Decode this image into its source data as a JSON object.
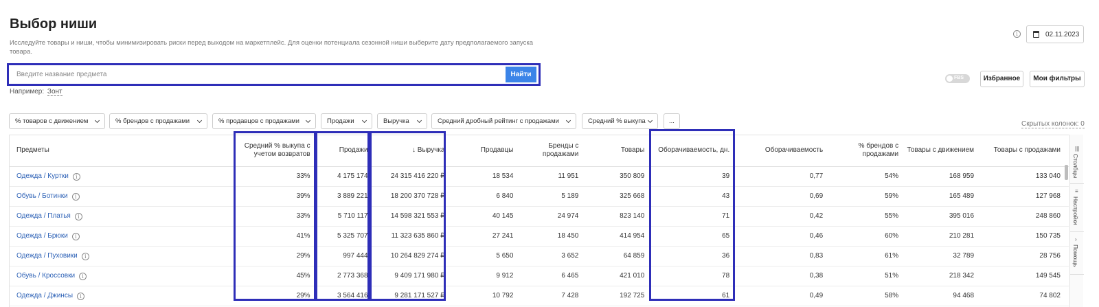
{
  "page": {
    "title": "Выбор ниши",
    "subtitle": "Исследуйте товары и ниши, чтобы минимизировать риски перед выходом на маркетплейс. Для оценки потенциала сезонной ниши выберите дату предполагаемого запуска товара."
  },
  "search": {
    "placeholder": "Введите название предмета",
    "button_label": "Найти",
    "example_label": "Например:",
    "example_value": "Зонт"
  },
  "header": {
    "info_icon": "info-icon",
    "date": "02.11.2023",
    "fbs_label": "FBS",
    "favorites_label": "Избранное",
    "my_filters_label": "Мои фильтры"
  },
  "filters": {
    "chips": [
      "% товаров с движением",
      "% брендов с продажами",
      "% продавцов с продажами",
      "Продажи",
      "Выручка",
      "Средний дробный рейтинг с продажами",
      "Средний % выкупа"
    ],
    "more_label": "...",
    "hidden_columns": "Скрытых колонок: 0"
  },
  "table": {
    "columns": [
      "Предметы",
      "Средний % выкупа с учетом возвратов",
      "Продажи",
      "↓ Выручка",
      "Продавцы",
      "Бренды с продажами",
      "Товары",
      "Оборачиваемость, дн.",
      "Оборачиваемость",
      "% брендов с продажами",
      "Товары с движением",
      "Товары с продажами"
    ],
    "rows": [
      [
        "Одежда / Куртки",
        "33%",
        "4 175 174",
        "24 315 416 220 ₽",
        "18 534",
        "11 951",
        "350 809",
        "39",
        "0,77",
        "54%",
        "168 959",
        "133 040"
      ],
      [
        "Обувь / Ботинки",
        "39%",
        "3 889 221",
        "18 200 370 728 ₽",
        "6 840",
        "5 189",
        "325 668",
        "43",
        "0,69",
        "59%",
        "165 489",
        "127 968"
      ],
      [
        "Одежда / Платья",
        "33%",
        "5 710 117",
        "14 598 321 553 ₽",
        "40 145",
        "24 974",
        "823 140",
        "71",
        "0,42",
        "55%",
        "395 016",
        "248 860"
      ],
      [
        "Одежда / Брюки",
        "41%",
        "5 325 707",
        "11 323 635 860 ₽",
        "27 241",
        "18 450",
        "414 954",
        "65",
        "0,46",
        "60%",
        "210 281",
        "150 735"
      ],
      [
        "Одежда / Пуховики",
        "29%",
        "997 444",
        "10 264 829 274 ₽",
        "5 650",
        "3 652",
        "64 859",
        "36",
        "0,83",
        "61%",
        "32 789",
        "28 756"
      ],
      [
        "Обувь / Кроссовки",
        "45%",
        "2 773 368",
        "9 409 171 980 ₽",
        "9 912",
        "6 465",
        "421 010",
        "78",
        "0,38",
        "51%",
        "218 342",
        "149 545"
      ],
      [
        "Одежда / Джинсы",
        "29%",
        "3 564 416",
        "9 281 171 527 ₽",
        "10 792",
        "7 428",
        "192 725",
        "61",
        "0,49",
        "58%",
        "94 468",
        "74 802"
      ]
    ]
  },
  "side_tabs": [
    {
      "label": "Столбцы",
      "icon": "columns-icon"
    },
    {
      "label": "Настройки",
      "icon": "settings-icon"
    },
    {
      "label": "Помощь",
      "icon": "help-icon"
    }
  ]
}
